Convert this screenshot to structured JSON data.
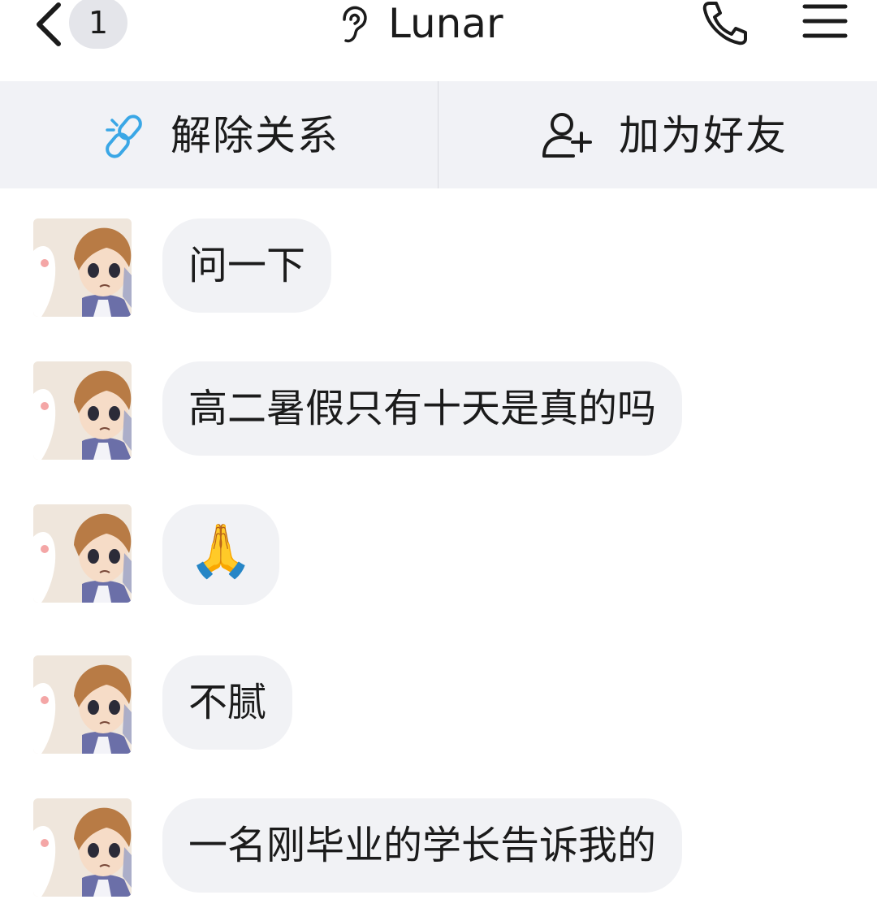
{
  "header": {
    "back_badge": "1",
    "title": "Lunar",
    "back_icon": "chevron-left-icon",
    "ear_icon": "ear-icon",
    "call_icon": "phone-icon",
    "menu_icon": "menu-icon"
  },
  "actions": {
    "unbind_label": "解除关系",
    "unbind_icon": "broken-link-icon",
    "add_friend_label": "加为好友",
    "add_friend_icon": "add-user-icon"
  },
  "colors": {
    "link_icon": "#3aa7e6",
    "bubble": "#f1f2f5",
    "action_bar": "#f1f2f6",
    "badge": "#e4e5ea"
  },
  "messages": [
    {
      "text": "问一下"
    },
    {
      "text": "高二暑假只有十天是真的吗"
    },
    {
      "text": "🙏"
    },
    {
      "text": "不腻"
    },
    {
      "text": "一名刚毕业的学长告诉我的"
    }
  ]
}
